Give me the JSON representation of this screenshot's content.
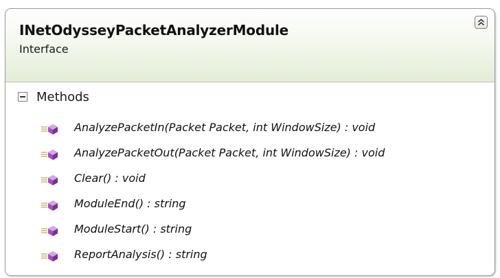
{
  "class_box": {
    "name": "INetOdysseyPacketAnalyzerModule",
    "stereotype": "Interface",
    "collapse_icon": "double-chevron-up-icon"
  },
  "methods_section": {
    "label": "Methods",
    "toggle_icon": "minus-box-icon",
    "items": [
      {
        "label": "AnalyzePacketIn(Packet Packet, int WindowSize) : void",
        "icon": "public-method-icon"
      },
      {
        "label": "AnalyzePacketOut(Packet Packet, int WindowSize) : void",
        "icon": "public-method-icon"
      },
      {
        "label": "Clear() : void",
        "icon": "public-method-icon"
      },
      {
        "label": "ModuleEnd() : string",
        "icon": "public-method-icon"
      },
      {
        "label": "ModuleStart() : string",
        "icon": "public-method-icon"
      },
      {
        "label": "ReportAnalysis() : string",
        "icon": "public-method-icon"
      }
    ]
  },
  "colors": {
    "header_gradient_end": "#e3ecd7",
    "method_icon": "#a14fc2",
    "border": "#9a9a9a"
  }
}
